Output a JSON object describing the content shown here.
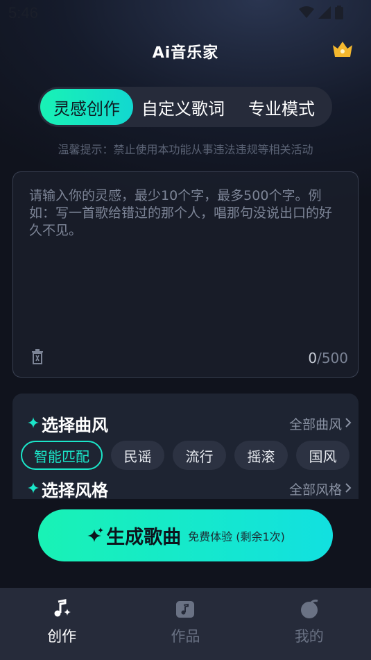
{
  "status_bar": {
    "time": "5:46"
  },
  "header": {
    "title_ai": "Ai",
    "title_rest": "音乐家"
  },
  "tabs": [
    {
      "label": "灵感创作",
      "active": true
    },
    {
      "label": "自定义歌词",
      "active": false
    },
    {
      "label": "专业模式",
      "active": false
    }
  ],
  "notice": "温馨提示：禁止使用本功能从事违法违规等相关活动",
  "inspiration_input": {
    "value": "",
    "placeholder": "请输入你的灵感，最少10个字，最多500个字。例如：写一首歌给错过的那个人，唱那句没说出口的好久不见。",
    "count_current": "0",
    "count_max": "/500"
  },
  "genre_section": {
    "title": "选择曲风",
    "more": "全部曲风",
    "chips": [
      "智能匹配",
      "民谣",
      "流行",
      "摇滚",
      "国风"
    ],
    "selected": "智能匹配"
  },
  "style_section": {
    "title": "选择风格",
    "more": "全部风格"
  },
  "generate_button": {
    "label": "生成歌曲",
    "sub": "免费体验 (剩余1次)"
  },
  "bottom_nav": [
    {
      "label": "创作",
      "icon": "music-note-icon",
      "active": true
    },
    {
      "label": "作品",
      "icon": "album-icon",
      "active": false
    },
    {
      "label": "我的",
      "icon": "profile-icon",
      "active": false
    }
  ],
  "colors": {
    "accent": "#1be6c9",
    "background": "#151b2b",
    "panel": "#1e2432"
  }
}
